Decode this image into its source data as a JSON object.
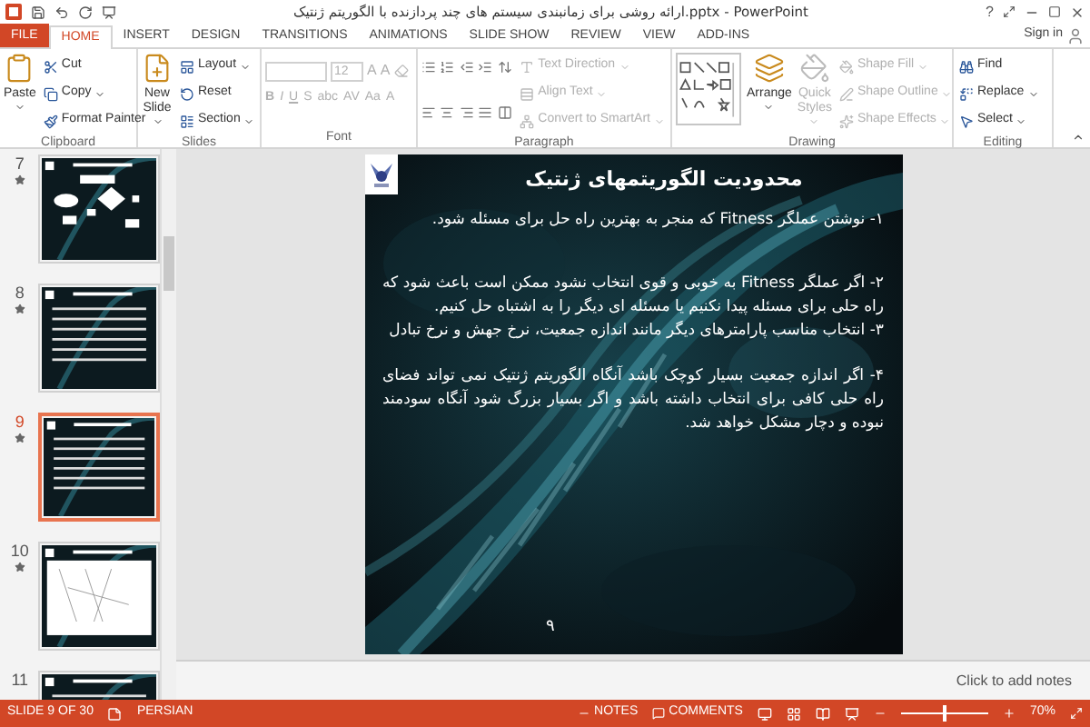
{
  "window": {
    "title": "ارائه روشی برای زمانبندی سیستم های چند پردازنده با الگوریتم ژنتیک.pptx - PowerPoint",
    "help": "?"
  },
  "tabs": [
    {
      "label": "FILE",
      "kind": "file",
      "selected": false
    },
    {
      "label": "HOME",
      "kind": "tab",
      "selected": true
    },
    {
      "label": "INSERT",
      "kind": "tab",
      "selected": false
    },
    {
      "label": "DESIGN",
      "kind": "tab",
      "selected": false
    },
    {
      "label": "TRANSITIONS",
      "kind": "tab",
      "selected": false
    },
    {
      "label": "ANIMATIONS",
      "kind": "tab",
      "selected": false
    },
    {
      "label": "SLIDE SHOW",
      "kind": "tab",
      "selected": false
    },
    {
      "label": "REVIEW",
      "kind": "tab",
      "selected": false
    },
    {
      "label": "VIEW",
      "kind": "tab",
      "selected": false
    },
    {
      "label": "ADD-INS",
      "kind": "tab",
      "selected": false
    }
  ],
  "sign_in": "Sign in",
  "ribbon": {
    "groups": [
      {
        "label": "Clipboard",
        "large": [
          {
            "label": "Paste",
            "disabled": false,
            "dropdown": true
          }
        ],
        "small": [
          {
            "label": "Cut",
            "disabled": false,
            "dropdown": false
          },
          {
            "label": "Copy",
            "disabled": false,
            "dropdown": true
          },
          {
            "label": "Format Painter",
            "disabled": false,
            "dropdown": false
          }
        ]
      },
      {
        "label": "Slides",
        "large": [
          {
            "label": "New Slide",
            "disabled": false,
            "dropdown": true
          }
        ],
        "small": [
          {
            "label": "Layout",
            "disabled": false,
            "dropdown": true
          },
          {
            "label": "Reset",
            "disabled": false,
            "dropdown": false
          },
          {
            "label": "Section",
            "disabled": false,
            "dropdown": true
          }
        ]
      },
      {
        "label": "Font",
        "kind": "font",
        "size": "12",
        "grow_shrink": [
          "A",
          "A"
        ],
        "buttons": [
          "B",
          "I",
          "U",
          "S",
          "abc",
          "AV",
          "Aa",
          "A"
        ],
        "disabled": true
      },
      {
        "label": "Paragraph",
        "kind": "paragraph",
        "small": [
          {
            "label": "Text Direction",
            "disabled": true,
            "dropdown": true
          },
          {
            "label": "Align Text",
            "disabled": true,
            "dropdown": true
          },
          {
            "label": "Convert to SmartArt",
            "disabled": true,
            "dropdown": true
          }
        ]
      },
      {
        "label": "Drawing",
        "kind": "drawing",
        "large": [
          {
            "label": "Arrange",
            "disabled": false,
            "dropdown": true
          },
          {
            "label": "Quick Styles",
            "disabled": true,
            "dropdown": true
          }
        ],
        "small": [
          {
            "label": "Shape Fill",
            "disabled": true,
            "dropdown": true
          },
          {
            "label": "Shape Outline",
            "disabled": true,
            "dropdown": true
          },
          {
            "label": "Shape Effects",
            "disabled": true,
            "dropdown": true
          }
        ]
      },
      {
        "label": "Editing",
        "small": [
          {
            "label": "Find",
            "disabled": false,
            "dropdown": false
          },
          {
            "label": "Replace",
            "disabled": false,
            "dropdown": true
          },
          {
            "label": "Select",
            "disabled": false,
            "dropdown": true
          }
        ]
      }
    ]
  },
  "thumbnails": [
    {
      "number": "7",
      "kind": "flowchart",
      "animated": true,
      "selected": false
    },
    {
      "number": "8",
      "kind": "text",
      "animated": true,
      "selected": false
    },
    {
      "number": "9",
      "kind": "text",
      "animated": true,
      "selected": true
    },
    {
      "number": "10",
      "kind": "diagram",
      "animated": true,
      "selected": false
    },
    {
      "number": "11",
      "kind": "text",
      "animated": false,
      "selected": false
    }
  ],
  "slide": {
    "title": "محدودیت الگوریتمهای ژنتیک",
    "paragraphs": [
      "۱- نوشتن عملگر Fitness که منجر به بهترین راه حل برای مسئله شود.",
      "۲- اگر عملگر Fitness به خوبی و قوی انتخاب نشود ممکن است باعث شود که راه حلی برای مسئله پیدا نکنیم یا مسئله ای دیگر را به اشتباه حل کنیم.",
      "۳- انتخاب مناسب پارامترهای دیگر مانند اندازه جمعیت، نرخ جهش و نرخ تبادل",
      "۴- اگر اندازه جمعیت بسیار کوچک باشد آنگاه الگوریتم ژنتیک نمی تواند فضای راه حلی کافی برای انتخاب داشته باشد و اگر بسیار بزرگ شود آنگاه سودمند نبوده و دچار مشکل خواهد شد."
    ],
    "page_number": "۹"
  },
  "notes_placeholder": "Click to add notes",
  "status_bar": {
    "slide": "SLIDE 9 OF 30",
    "language": "PERSIAN",
    "notes": "NOTES",
    "comments": "COMMENTS",
    "zoom": "70%",
    "zoom_slider": {
      "level": 0.5
    }
  }
}
